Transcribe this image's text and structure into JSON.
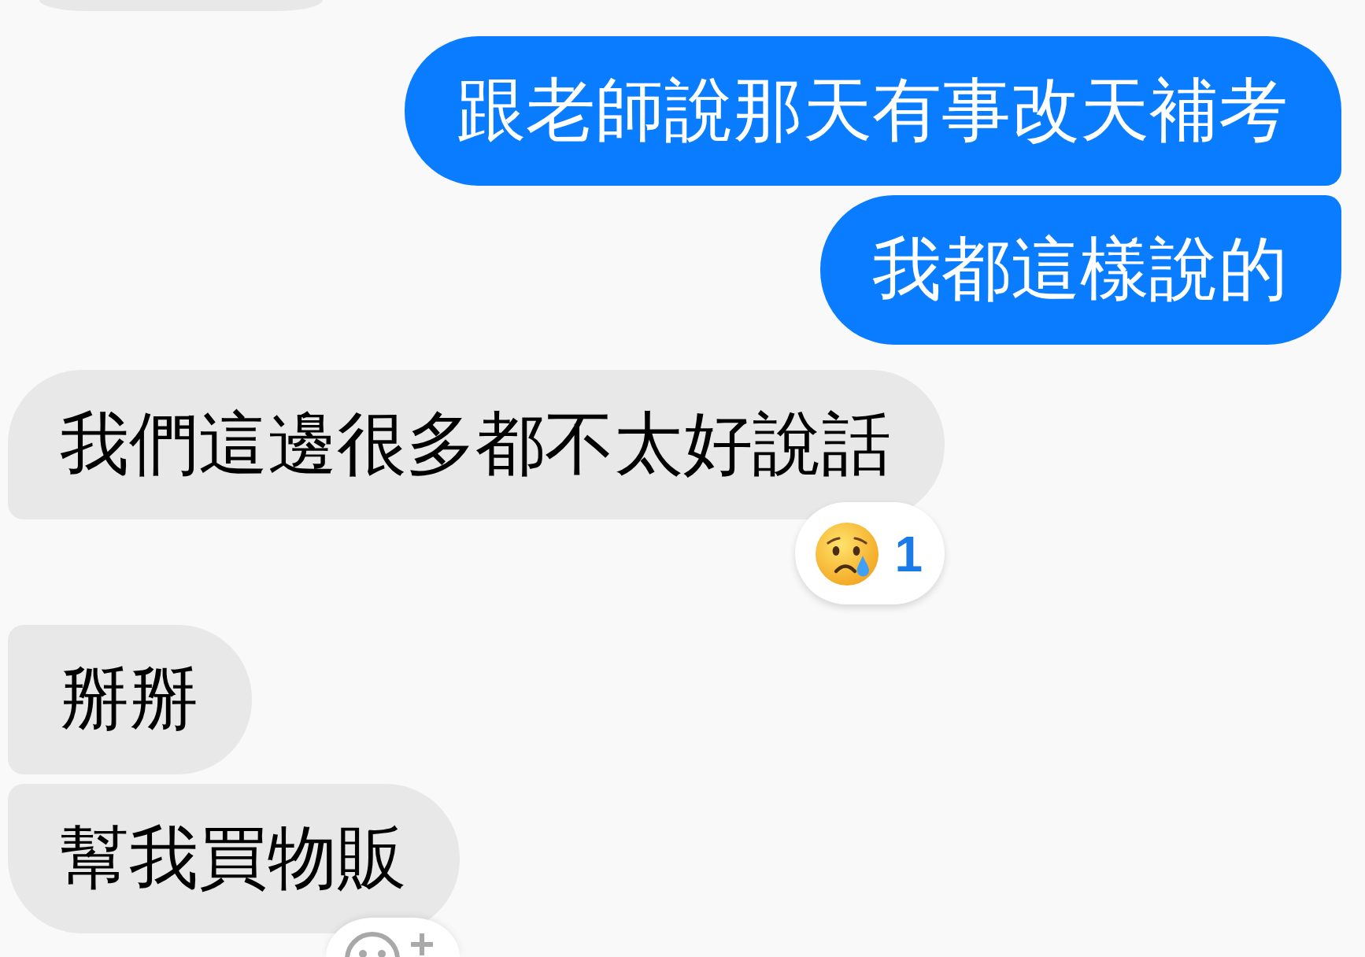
{
  "messages": [
    {
      "kind": "received"
    },
    {
      "kind": "sent",
      "text": "跟老師說那天有事改天補考"
    },
    {
      "kind": "sent",
      "text": "我都這樣說的"
    },
    {
      "kind": "received",
      "text": "我們這邊很多都不太好說話",
      "reaction": {
        "kind": "emoji",
        "count": "1"
      }
    },
    {
      "kind": "received",
      "text": "掰掰"
    },
    {
      "kind": "received",
      "text": "幫我買物販",
      "reaction": {
        "kind": "add"
      }
    }
  ]
}
